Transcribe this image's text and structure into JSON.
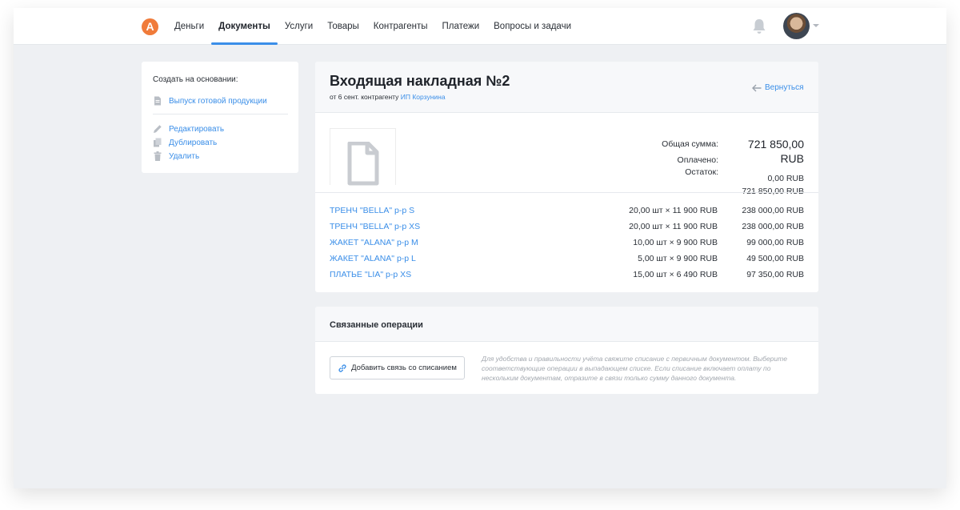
{
  "app": {
    "logo_letter": "A",
    "accent": "#3a8ee8",
    "logo_color": "#f07b3a"
  },
  "nav": {
    "items": [
      {
        "label": "Деньги"
      },
      {
        "label": "Документы"
      },
      {
        "label": "Услуги"
      },
      {
        "label": "Товары"
      },
      {
        "label": "Контрагенты"
      },
      {
        "label": "Платежи"
      },
      {
        "label": "Вопросы и задачи"
      }
    ],
    "active": "Документы"
  },
  "sidebar": {
    "create_title": "Создать на основании:",
    "create_link": "Выпуск готовой продукции",
    "actions": [
      {
        "label": "Редактировать",
        "icon": "pencil-icon"
      },
      {
        "label": "Дублировать",
        "icon": "copy-icon"
      },
      {
        "label": "Удалить",
        "icon": "trash-icon"
      }
    ]
  },
  "document": {
    "title": "Входящая накладная №2",
    "subtitle_prefix": "от 6 сент. контрагенту",
    "counterparty": "ИП Корзунина",
    "back_label": "Вернуться",
    "totals": {
      "total_label": "Общая сумма:",
      "total_value": "721 850,00",
      "paid_label": "Оплачено:",
      "currency": "RUB",
      "rest_label": "Остаток:",
      "paid_value": "0,00 RUB",
      "rest_value": "721 850,00 RUB"
    },
    "items": [
      {
        "name": "ТРЕНЧ \"BELLA\" р-р S",
        "qty": "20,00 шт × 11 900 RUB",
        "sum": "238 000,00 RUB"
      },
      {
        "name": "ТРЕНЧ \"BELLA\" р-р XS",
        "qty": "20,00 шт × 11 900 RUB",
        "sum": "238 000,00 RUB"
      },
      {
        "name": "ЖАКЕТ \"ALANA\" р-р M",
        "qty": "10,00 шт × 9 900 RUB",
        "sum": "99 000,00 RUB"
      },
      {
        "name": "ЖАКЕТ \"ALANA\" р-р L",
        "qty": "5,00 шт × 9 900 RUB",
        "sum": "49 500,00 RUB"
      },
      {
        "name": "ПЛАТЬЕ \"LIA\" р-р XS",
        "qty": "15,00 шт × 6 490 RUB",
        "sum": "97 350,00 RUB"
      }
    ]
  },
  "related": {
    "title": "Связанные операции",
    "button_label": "Добавить связь со списанием",
    "hint": "Для удобства и правильности учёта свяжите списание с первичным документом. Выберите соответствующие операции в выпадающем списке. Если списание включает оплату по нескольким документам, отразите в связи только сумму данного документа."
  }
}
